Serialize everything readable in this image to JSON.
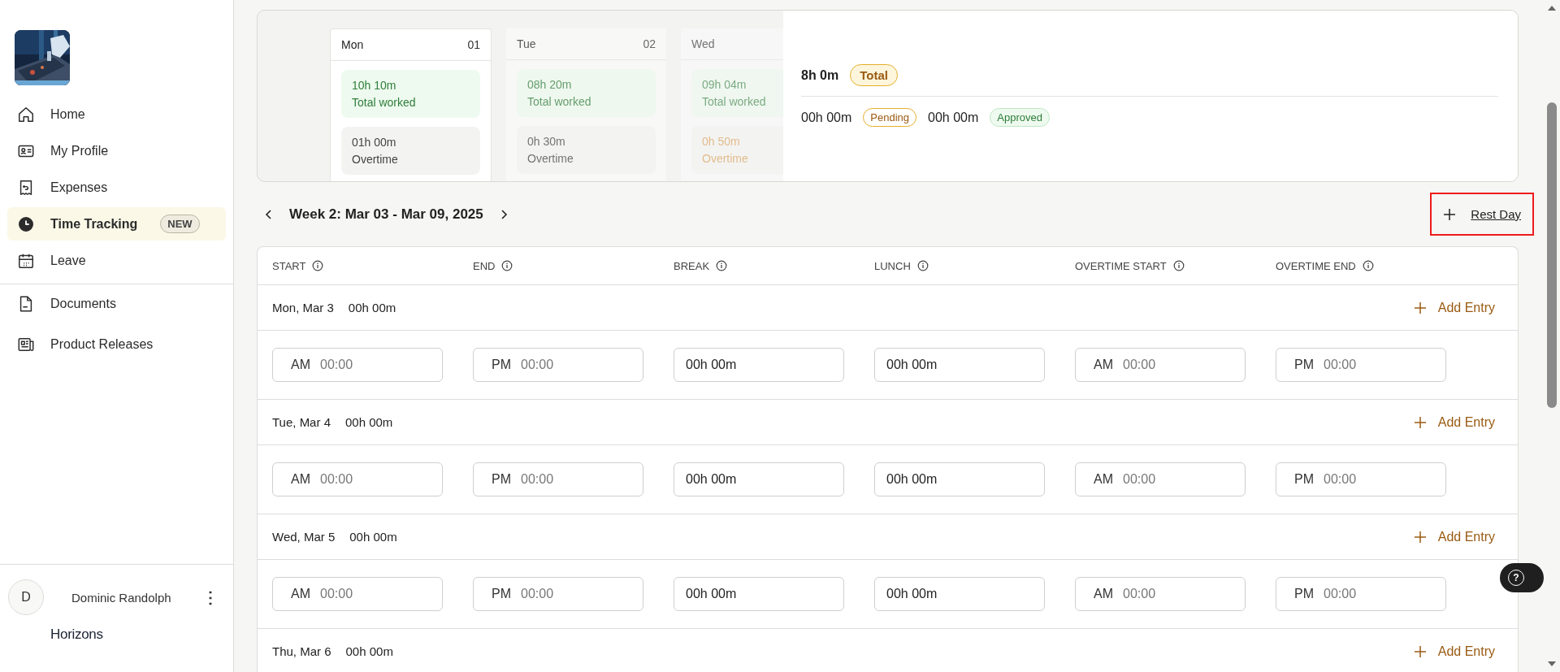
{
  "sidebar": {
    "items": [
      {
        "label": "Home",
        "selected": false
      },
      {
        "label": "My Profile",
        "selected": false
      },
      {
        "label": "Expenses",
        "selected": false
      },
      {
        "label": "Time Tracking",
        "selected": true,
        "badge": "NEW"
      },
      {
        "label": "Leave",
        "selected": false
      }
    ],
    "secondary_items": [
      {
        "label": "Documents",
        "selected": false
      },
      {
        "label": "Product Releases",
        "selected": false
      }
    ],
    "user": {
      "initial": "D",
      "name": "Dominic Randolph",
      "menu": "⋮"
    },
    "brand": "Horizons"
  },
  "summary": {
    "days": [
      {
        "day": "Mon",
        "date": "01",
        "selected": true,
        "worked": "10h 10m",
        "worked_label": "Total worked",
        "overtime": "01h 00m",
        "overtime_label": "Overtime",
        "flagged": false
      },
      {
        "day": "Tue",
        "date": "02",
        "selected": false,
        "worked": "08h 20m",
        "worked_label": "Total worked",
        "overtime": "0h 30m",
        "overtime_label": "Overtime",
        "flagged": false
      },
      {
        "day": "Wed",
        "selected": false,
        "worked": "09h 04m",
        "worked_label": "Total worked",
        "overtime": "0h 50m",
        "overtime_label": "Overtime",
        "flagged": true
      }
    ],
    "total": {
      "value": "8h 0m",
      "badge": "Total",
      "kind": "total"
    },
    "statuses": [
      {
        "value": "00h 00m",
        "badge": "Pending",
        "kind": "pending"
      },
      {
        "value": "00h 00m",
        "badge": "Approved",
        "kind": "approved"
      }
    ]
  },
  "week": {
    "title": "Week 2: Mar 03 - Mar 09, 2025",
    "rest_day": {
      "label": "Rest Day",
      "highlighted": true
    }
  },
  "table": {
    "columns": [
      "START",
      "END",
      "BREAK",
      "LUNCH",
      "OVERTIME START",
      "OVERTIME END"
    ],
    "days": [
      {
        "label": "Mon, Mar 3",
        "total": "00h 00m",
        "action": "Add Entry",
        "fields": [
          {
            "prefix": "AM",
            "placeholder": "00:00"
          },
          {
            "prefix": "PM",
            "placeholder": "00:00"
          },
          {
            "value": "00h 00m"
          },
          {
            "value": "00h 00m"
          },
          {
            "prefix": "AM",
            "placeholder": "00:00"
          },
          {
            "prefix": "PM",
            "placeholder": "00:00"
          }
        ]
      },
      {
        "label": "Tue, Mar 4",
        "total": "00h 00m",
        "action": "Add Entry",
        "fields": [
          {
            "prefix": "AM",
            "placeholder": "00:00"
          },
          {
            "prefix": "PM",
            "placeholder": "00:00"
          },
          {
            "value": "00h 00m"
          },
          {
            "value": "00h 00m"
          },
          {
            "prefix": "AM",
            "placeholder": "00:00"
          },
          {
            "prefix": "PM",
            "placeholder": "00:00"
          }
        ]
      },
      {
        "label": "Wed, Mar 5",
        "total": "00h 00m",
        "action": "Add Entry",
        "fields": [
          {
            "prefix": "AM",
            "placeholder": "00:00"
          },
          {
            "prefix": "PM",
            "placeholder": "00:00"
          },
          {
            "value": "00h 00m"
          },
          {
            "value": "00h 00m"
          },
          {
            "prefix": "AM",
            "placeholder": "00:00"
          },
          {
            "prefix": "PM",
            "placeholder": "00:00"
          }
        ]
      },
      {
        "label": "Thu, Mar 6",
        "total": "00h 00m",
        "action": "Add Entry"
      }
    ]
  },
  "help": "?"
}
